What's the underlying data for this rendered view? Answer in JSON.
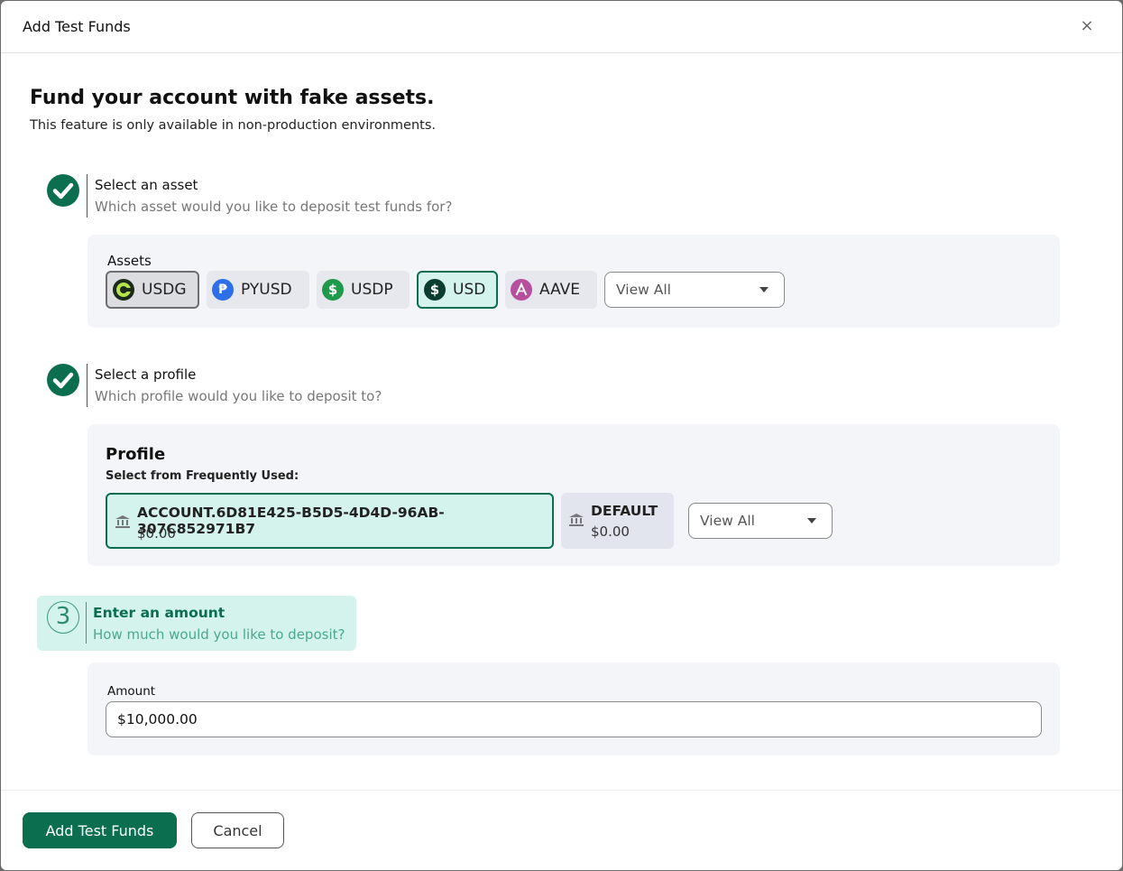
{
  "modal": {
    "title": "Add Test Funds",
    "close_glyph": "×"
  },
  "intro": {
    "heading": "Fund your account with fake assets.",
    "subheading": "This feature is only available in non-production environments."
  },
  "step1": {
    "title": "Select an asset",
    "desc": "Which asset would you like to deposit test funds for?"
  },
  "assets": {
    "label": "Assets",
    "items": [
      {
        "label": "USDG",
        "icon": "usdg-icon",
        "state": "selected-gray"
      },
      {
        "label": "PYUSD",
        "icon": "pyusd-icon",
        "state": "default"
      },
      {
        "label": "USDP",
        "icon": "usdp-icon",
        "state": "default"
      },
      {
        "label": "USD",
        "icon": "usd-icon",
        "state": "selected"
      },
      {
        "label": "AAVE",
        "icon": "aave-icon",
        "state": "default"
      }
    ],
    "view_all": "View All"
  },
  "step2": {
    "title": "Select a profile",
    "desc": "Which profile would you like to deposit to?"
  },
  "profile": {
    "title": "Profile",
    "subtitle": "Select from Frequently Used:",
    "accounts": [
      {
        "name": "ACCOUNT.6D81E425-B5D5-4D4D-96AB-307C852971B7",
        "balance": "$0.00",
        "selected": true
      },
      {
        "name": "DEFAULT",
        "balance": "$0.00",
        "selected": false
      }
    ],
    "view_all": "View All"
  },
  "step3": {
    "number": "3",
    "title": "Enter an amount",
    "desc": "How much would you like to deposit?"
  },
  "amount": {
    "label": "Amount",
    "value": "$10,000.00"
  },
  "footer": {
    "submit_label": "Add Test Funds",
    "cancel_label": "Cancel"
  },
  "colors": {
    "accent": "#0b6e4f",
    "accent_light": "#d3f3ec",
    "panel": "#f4f5f8"
  }
}
